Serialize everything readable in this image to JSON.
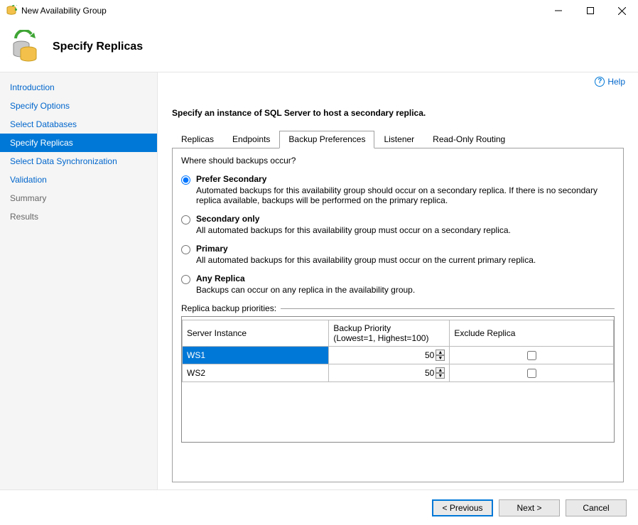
{
  "window": {
    "title": "New Availability Group"
  },
  "header": {
    "heading": "Specify Replicas"
  },
  "help": {
    "label": "Help"
  },
  "sidebar": {
    "items": [
      {
        "label": "Introduction",
        "state": "done"
      },
      {
        "label": "Specify Options",
        "state": "done"
      },
      {
        "label": "Select Databases",
        "state": "done"
      },
      {
        "label": "Specify Replicas",
        "state": "active"
      },
      {
        "label": "Select Data Synchronization",
        "state": "done"
      },
      {
        "label": "Validation",
        "state": "done"
      },
      {
        "label": "Summary",
        "state": "pending"
      },
      {
        "label": "Results",
        "state": "pending"
      }
    ]
  },
  "main": {
    "instruction": "Specify an instance of SQL Server to host a secondary replica.",
    "tabs": [
      {
        "label": "Replicas"
      },
      {
        "label": "Endpoints"
      },
      {
        "label": "Backup Preferences"
      },
      {
        "label": "Listener"
      },
      {
        "label": "Read-Only Routing"
      }
    ],
    "active_tab": 2,
    "backup_prefs": {
      "question": "Where should backups occur?",
      "options": [
        {
          "title": "Prefer Secondary",
          "desc": "Automated backups for this availability group should occur on a secondary replica. If there is no secondary replica available, backups will be performed on the primary replica.",
          "checked": true
        },
        {
          "title": "Secondary only",
          "desc": "All automated backups for this availability group must occur on a secondary replica.",
          "checked": false
        },
        {
          "title": "Primary",
          "desc": "All automated backups for this availability group must occur on the current primary replica.",
          "checked": false
        },
        {
          "title": "Any Replica",
          "desc": "Backups can occur on any replica in the availability group.",
          "checked": false
        }
      ],
      "priorities_label": "Replica backup priorities:",
      "columns": {
        "server": "Server Instance",
        "priority": "Backup Priority\n(Lowest=1, Highest=100)",
        "exclude": "Exclude Replica"
      },
      "rows": [
        {
          "server": "WS1",
          "priority": "50",
          "exclude": false,
          "selected": true
        },
        {
          "server": "WS2",
          "priority": "50",
          "exclude": false,
          "selected": false
        }
      ]
    }
  },
  "footer": {
    "previous": "< Previous",
    "next": "Next >",
    "cancel": "Cancel"
  }
}
